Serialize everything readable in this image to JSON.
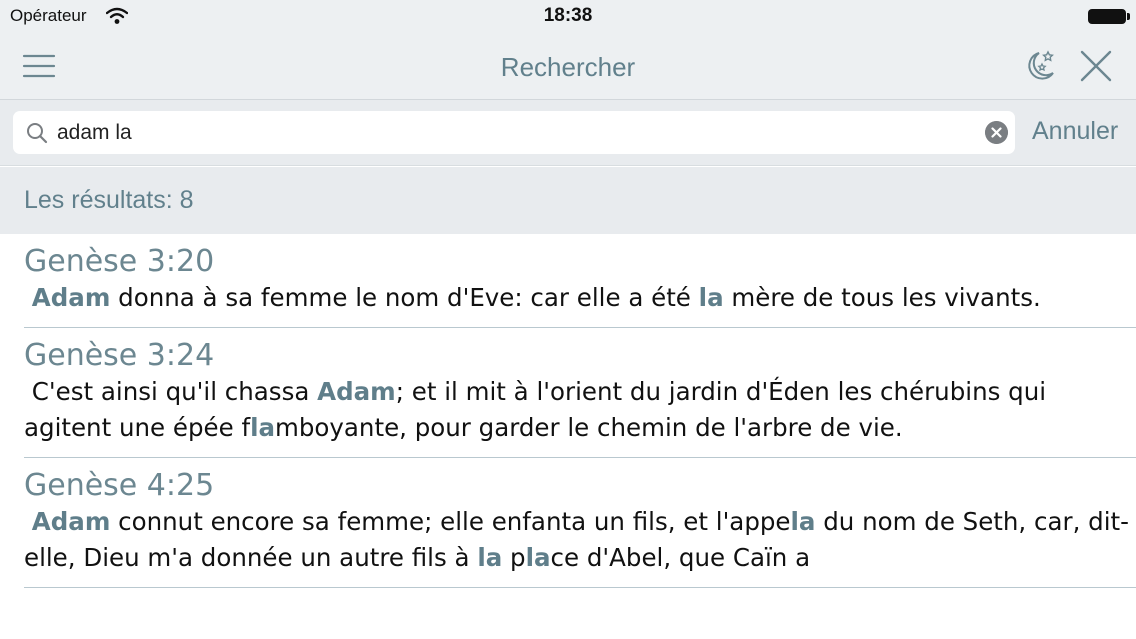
{
  "status_bar": {
    "carrier": "Opérateur",
    "time": "18:38"
  },
  "nav": {
    "title": "Rechercher",
    "icons": [
      "menu-icon",
      "night-mode-icon",
      "close-icon"
    ]
  },
  "search": {
    "query": "adam la",
    "cancel_label": "Annuler",
    "icons": [
      "search-icon",
      "clear-icon"
    ]
  },
  "results_label": "Les résultats: 8",
  "colors": {
    "accent": "#61808c",
    "highlight": "#5f7e8a",
    "bar_background": "#edf0f2",
    "divider": "#b9c8cf"
  },
  "results": [
    {
      "ref": "Genèse 3:20",
      "segments": [
        {
          "t": " ",
          "h": false
        },
        {
          "t": "Adam",
          "h": true
        },
        {
          "t": " donna à sa femme le nom d'Eve: car elle a été ",
          "h": false
        },
        {
          "t": "la",
          "h": true
        },
        {
          "t": " mère de tous les vivants.",
          "h": false
        }
      ]
    },
    {
      "ref": "Genèse 3:24",
      "segments": [
        {
          "t": " C'est ainsi qu'il chassa ",
          "h": false
        },
        {
          "t": "Adam",
          "h": true
        },
        {
          "t": "; et il mit à l'orient du jardin d'Éden les chérubins qui agitent une épée f",
          "h": false
        },
        {
          "t": "la",
          "h": true
        },
        {
          "t": "mboyante, pour garder le chemin de l'arbre de vie.",
          "h": false
        }
      ]
    },
    {
      "ref": "Genèse 4:25",
      "segments": [
        {
          "t": " ",
          "h": false
        },
        {
          "t": "Adam",
          "h": true
        },
        {
          "t": " connut encore sa femme; elle enfanta un fils, et l'appe",
          "h": false
        },
        {
          "t": "la",
          "h": true
        },
        {
          "t": " du nom de Seth, car, dit-elle, Dieu m'a donnée un autre fils à ",
          "h": false
        },
        {
          "t": "la",
          "h": true
        },
        {
          "t": " p",
          "h": false
        },
        {
          "t": "la",
          "h": true
        },
        {
          "t": "ce d'Abel, que Caïn a",
          "h": false
        }
      ]
    }
  ]
}
